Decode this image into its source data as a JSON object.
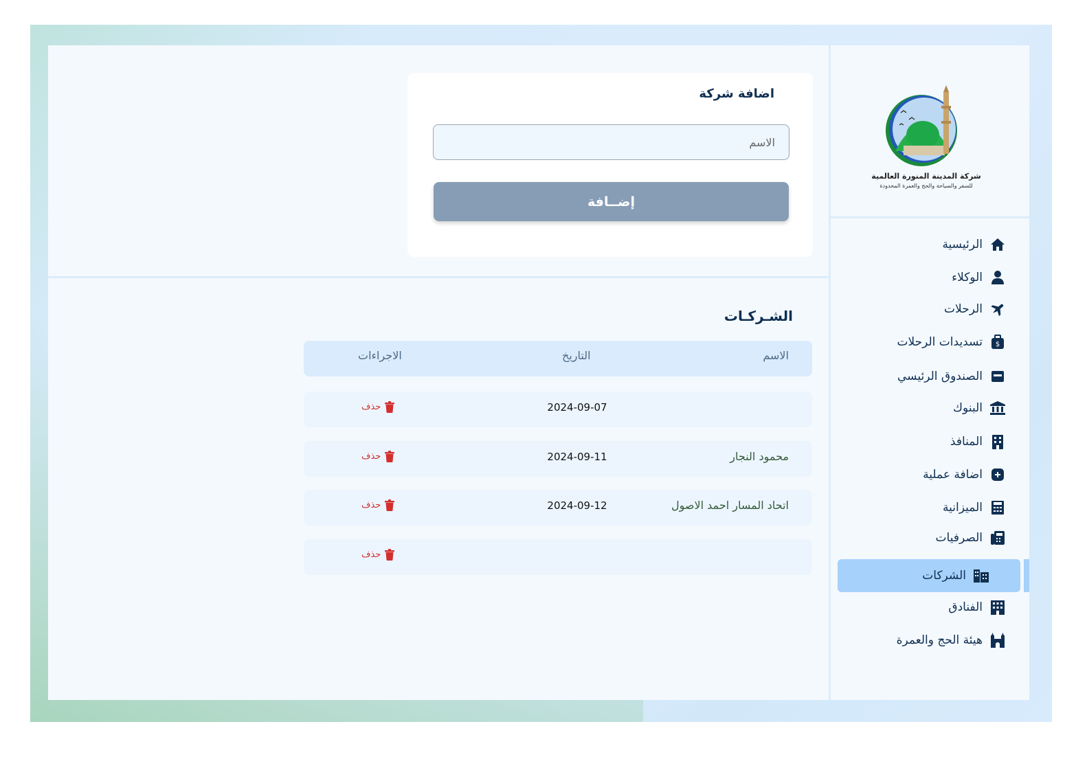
{
  "logo": {
    "title": "شركة المدينة المنورة العالمية",
    "subtitle": "للسفر والسياحة والحج والعمرة المحدودة"
  },
  "sidebar": {
    "items": [
      {
        "label": "الرئيسية",
        "icon": "home-icon"
      },
      {
        "label": "الوكلاء",
        "icon": "agent-icon"
      },
      {
        "label": "الرحلات",
        "icon": "plane-icon"
      },
      {
        "label": "تسديدات الرحلات",
        "icon": "money-bag-icon"
      },
      {
        "label": "الصندوق الرئيسي",
        "icon": "cash-box-icon"
      },
      {
        "label": "البنوك",
        "icon": "bank-icon"
      },
      {
        "label": "المنافذ",
        "icon": "building-icon"
      },
      {
        "label": "اضافة عملية",
        "icon": "plus-square-icon"
      },
      {
        "label": "الميزانية",
        "icon": "calculator-icon"
      },
      {
        "label": "الصرفيات",
        "icon": "cash-register-icon"
      },
      {
        "label": "الشركات",
        "icon": "city-icon",
        "active": true
      },
      {
        "label": "الفنادق",
        "icon": "hotel-icon"
      },
      {
        "label": "هيئة الحج والعمرة",
        "icon": "kaaba-icon"
      }
    ]
  },
  "form": {
    "title": "اضافة شركة",
    "name_placeholder": "الاسم",
    "add_label": "إضــافة"
  },
  "table": {
    "title": "الشـركـات",
    "headers": {
      "name": "الاسم",
      "date": "التاريخ",
      "actions": "الاجراءات"
    },
    "delete_label": "حذف",
    "rows": [
      {
        "name": "",
        "date": "2024-09-07"
      },
      {
        "name": "محمود النجار",
        "date": "2024-09-11"
      },
      {
        "name": "اتحاد المسار احمد الاصول",
        "date": "2024-09-12"
      },
      {
        "name": "",
        "date": ""
      }
    ]
  },
  "colors": {
    "primary_text": "#0f2f52",
    "active_nav": "#a6d1fb",
    "add_button": "#879db5",
    "delete": "#d32f2f",
    "table_header": "#d9ebfc"
  }
}
